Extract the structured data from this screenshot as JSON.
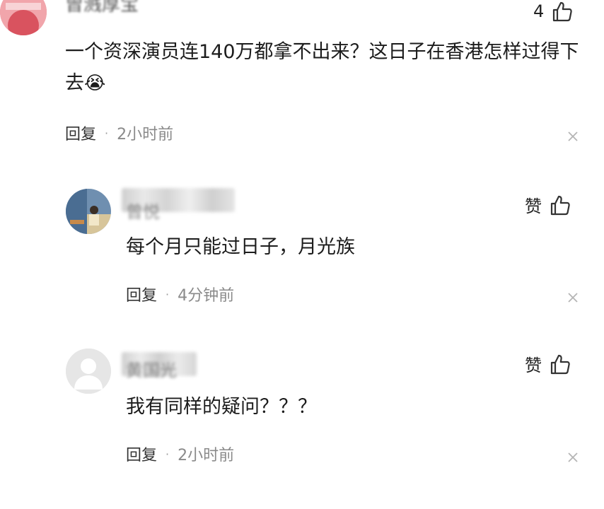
{
  "top_comment": {
    "author_name": "曾溅厚宝",
    "like_count": "4",
    "text": "一个资深演员连140万都拿不出来？这日子在香港怎样过得下去",
    "emoji": "😭",
    "reply_label": "回复",
    "separator": "·",
    "time": "2小时前",
    "icons": {
      "like": "thumbs-up-icon",
      "close": "close-icon"
    }
  },
  "replies": [
    {
      "author_name": "曾悦",
      "like_label": "赞",
      "text": "每个月只能过日子，月光族",
      "reply_label": "回复",
      "separator": "·",
      "time": "4分钟前"
    },
    {
      "author_name": "黄国光",
      "like_label": "赞",
      "text": "我有同样的疑问？？？",
      "reply_label": "回复",
      "separator": "·",
      "time": "2小时前"
    }
  ],
  "colors": {
    "text": "#1c1c1c",
    "meta_time": "#8a8a8a",
    "icon": "#333333",
    "default_avatar": "#e6e6e6"
  }
}
